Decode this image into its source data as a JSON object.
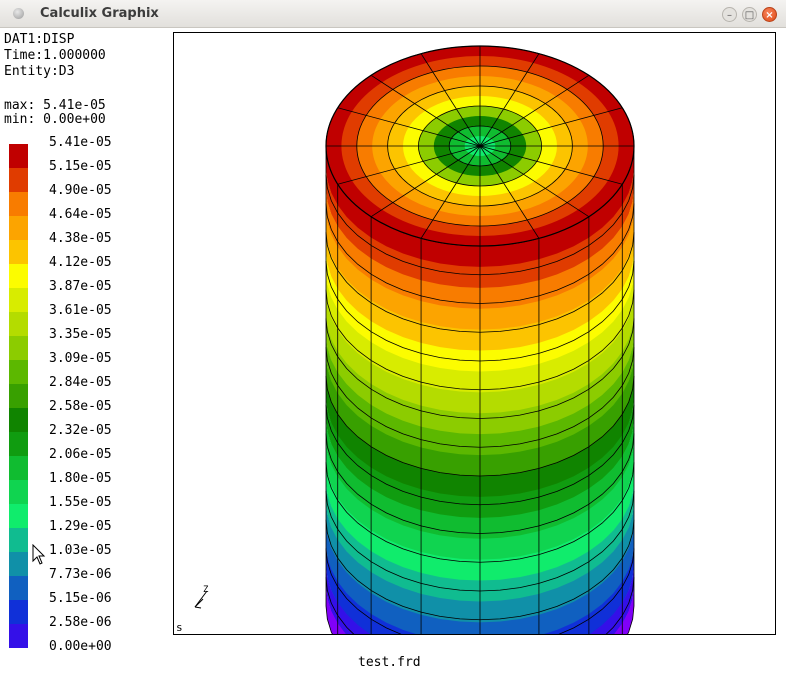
{
  "window": {
    "title": "Calculix Graphix",
    "controls": {
      "minimize": "–",
      "maximize": "□",
      "close": "×"
    }
  },
  "info": {
    "dataset": "DAT1:DISP",
    "time": "Time:1.000000",
    "entity": "Entity:D3",
    "max": "max: 5.41e-05",
    "min": "min: 0.00e+00"
  },
  "legend": {
    "labels": [
      "5.41e-05",
      "5.15e-05",
      "4.90e-05",
      "4.64e-05",
      "4.38e-05",
      "4.12e-05",
      "3.87e-05",
      "3.61e-05",
      "3.35e-05",
      "3.09e-05",
      "2.84e-05",
      "2.58e-05",
      "2.32e-05",
      "2.06e-05",
      "1.80e-05",
      "1.55e-05",
      "1.29e-05",
      "1.03e-05",
      "7.73e-06",
      "5.15e-06",
      "2.58e-06",
      "0.00e+00"
    ],
    "colors": [
      "#c00000",
      "#e03c00",
      "#f87c00",
      "#fca400",
      "#fcc400",
      "#fcfc00",
      "#d8ec00",
      "#b4dc00",
      "#8ccc00",
      "#5cb800",
      "#38a000",
      "#108400",
      "#109c10",
      "#10bc30",
      "#10d450",
      "#10ec6c",
      "#10bc90",
      "#1090a8",
      "#1060c0",
      "#1030d8",
      "#3410e8",
      "#8000f8"
    ]
  },
  "viewport": {
    "axis_label": "Z",
    "corner_label": "s"
  },
  "footer": {
    "filename": "test.frd"
  }
}
